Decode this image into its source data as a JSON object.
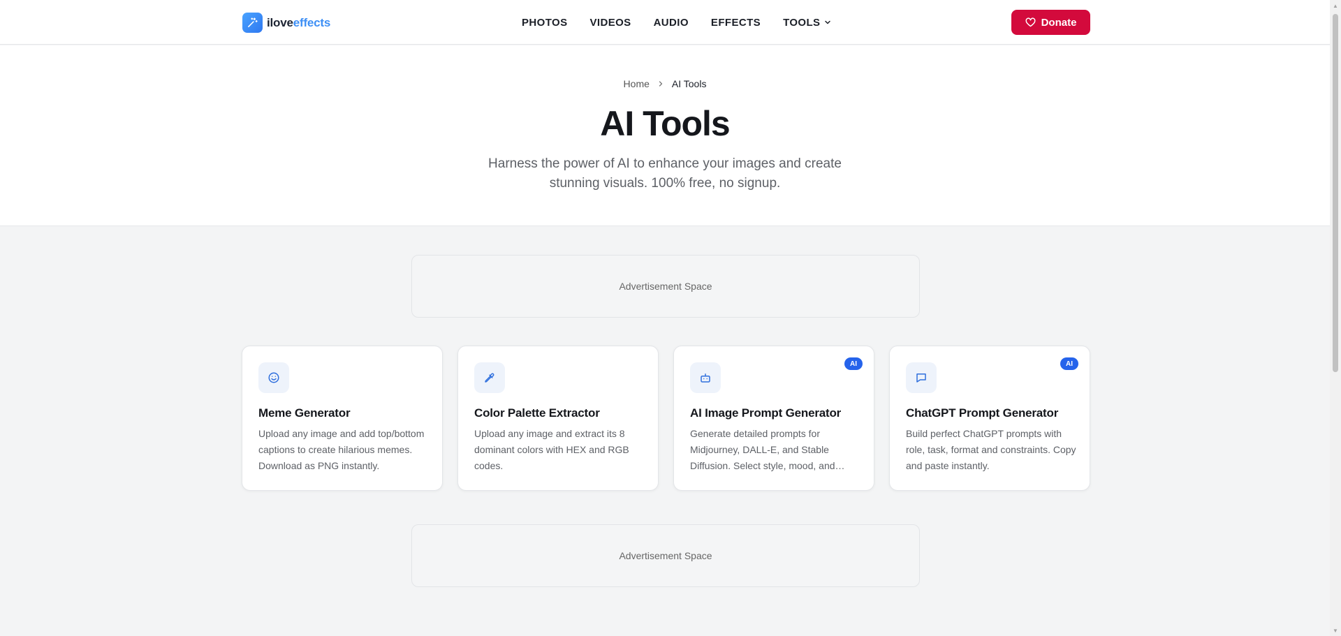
{
  "header": {
    "logo": {
      "prefix": "ilove",
      "accent": "effects"
    },
    "nav": [
      {
        "label": "PHOTOS"
      },
      {
        "label": "VIDEOS"
      },
      {
        "label": "AUDIO"
      },
      {
        "label": "EFFECTS"
      },
      {
        "label": "TOOLS",
        "icon": "chevron-down-icon"
      }
    ],
    "donate_label": "Donate"
  },
  "hero": {
    "breadcrumb": {
      "home": "Home",
      "current": "AI Tools"
    },
    "title": "AI Tools",
    "subtitle": "Harness the power of AI to enhance your images and create stunning visuals. 100% free, no signup."
  },
  "ads": {
    "top": "Advertisement Space",
    "bottom": "Advertisement Space"
  },
  "cards": [
    {
      "title": "Meme Generator",
      "description": "Upload any image and add top/bottom captions to create hilarious memes. Download as PNG instantly.",
      "icon": "smile-icon"
    },
    {
      "title": "Color Palette Extractor",
      "description": "Upload any image and extract its 8 dominant colors with HEX and RGB codes.",
      "icon": "eyedropper-icon"
    },
    {
      "title": "AI Image Prompt Generator",
      "description": "Generate detailed prompts for Midjourney, DALL-E, and Stable Diffusion. Select style, mood, and more.",
      "icon": "robot-icon",
      "badge": "AI"
    },
    {
      "title": "ChatGPT Prompt Generator",
      "description": "Build perfect ChatGPT prompts with role, task, format and constraints. Copy and paste instantly.",
      "icon": "chat-bubble-icon",
      "badge": "AI"
    }
  ],
  "colors": {
    "brand": "#3d8ff5",
    "donate": "#d30a3c",
    "badge": "#2563eb",
    "icon_bg": "#eef3fb"
  }
}
